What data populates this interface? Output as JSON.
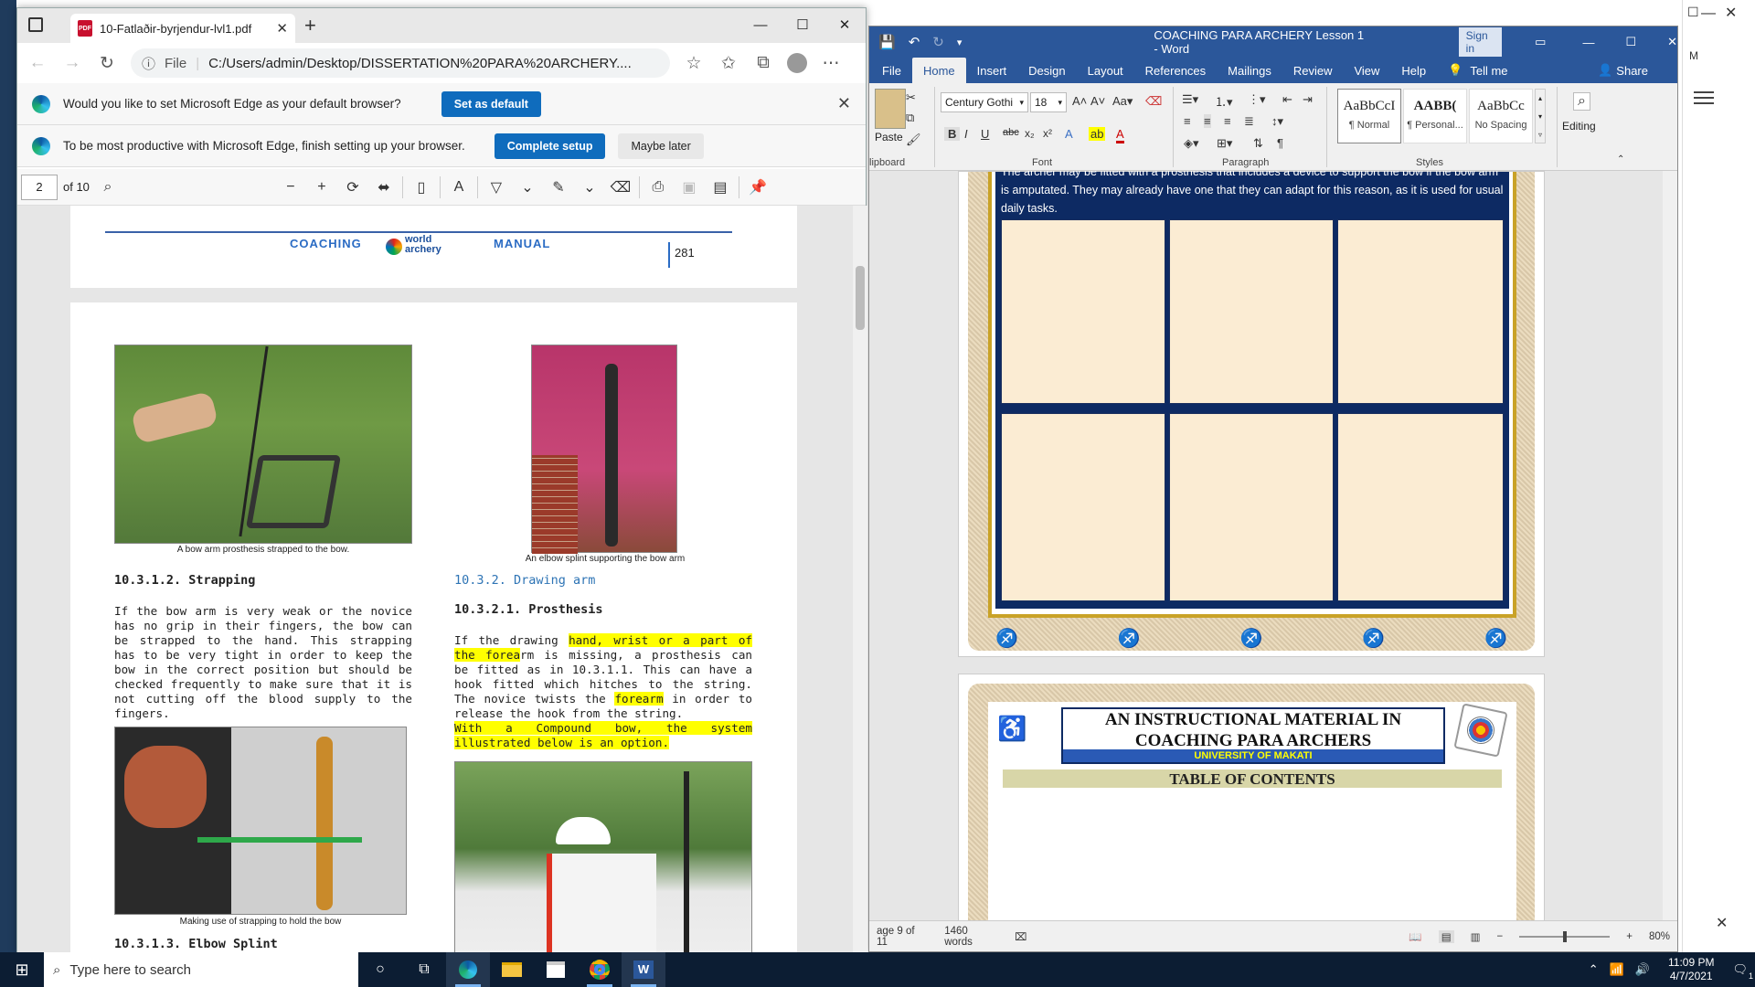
{
  "edge": {
    "tab_title": "10-Fatlaðir-byrjendur-lvl1.pdf",
    "url_scheme": "File",
    "url": "C:/Users/admin/Desktop/DISSERTATION%20PARA%20ARCHERY....",
    "infobar1_text": "Would you like to set Microsoft Edge as your default browser?",
    "infobar1_button": "Set as default",
    "infobar2_text": "To be most productive with Microsoft Edge, finish setting up your browser.",
    "infobar2_primary": "Complete setup",
    "infobar2_secondary": "Maybe later",
    "page_number": "2",
    "page_total": "of 10"
  },
  "pdf": {
    "header_left": "COACHING",
    "header_logo": "world archery",
    "header_right": "MANUAL",
    "page_num": "281",
    "cap1": "A bow arm prosthesis strapped to the bow.",
    "cap2": "An elbow splint supporting the bow arm",
    "cap3": "Making use of strapping to hold the bow",
    "h_strapping": "10.3.1.2. Strapping",
    "p_strapping": "If the bow arm is very weak or the novice has no grip in their fingers, the bow can be strapped to the hand. This strapping has to be very tight in order to keep the bow in the correct position but should be checked frequently to make sure that it is not cutting off the blood supply to the fingers.",
    "h_elbow": "10.3.1.3. Elbow Splint",
    "h_drawing": "10.3.2. Drawing arm",
    "h_prosthesis": "10.3.2.1. Prosthesis",
    "p_pros_a": "If the drawing ",
    "p_pros_hl1": "hand, wrist or a part of the forea",
    "p_pros_b": "rm is missing, a prosthesis can be fitted as in 10.3.1.1. This can have a hook fitted which hitches to the string. The novice twists the ",
    "p_pros_hl2": "forearm",
    "p_pros_c": " in order to release the hook from the string.",
    "p_pros_hl3": "With a Compound bow, the system illustrated below is an option."
  },
  "word": {
    "title": "COACHING PARA ARCHERY Lesson 1  -  Word",
    "sign_in": "Sign in",
    "tabs": [
      "File",
      "Home",
      "Insert",
      "Design",
      "Layout",
      "References",
      "Mailings",
      "Review",
      "View",
      "Help",
      "Tell me"
    ],
    "share": "Share",
    "avatar": "M",
    "paste": "Paste",
    "clipboard": "lipboard",
    "font_name": "Century Gothi",
    "font_size": "18",
    "group_font": "Font",
    "group_paragraph": "Paragraph",
    "group_styles": "Styles",
    "styles": [
      {
        "preview": "AaBbCcI",
        "name": "¶ Normal"
      },
      {
        "preview": "AABB(",
        "name": "¶ Personal..."
      },
      {
        "preview": "AaBbCc",
        "name": "No Spacing"
      }
    ],
    "editing": "Editing",
    "doc_text": "The archer may be fitted with a prosthesis that includes a device to support the bow if the bow arm is amputated. They may already have one that they can adapt for this reason, as it is used for usual daily tasks.",
    "next_title1": "AN INSTRUCTIONAL MATERIAL IN",
    "next_title2": "COACHING PARA ARCHERS",
    "next_univ": "UNIVERSITY OF MAKATI",
    "next_toc": "TABLE OF CONTENTS",
    "status_page": "age 9 of 11",
    "status_words": "1460 words",
    "zoom": "80%"
  },
  "taskbar": {
    "search_placeholder": "Type here to search",
    "time": "11:09 PM",
    "date": "4/7/2021",
    "notif_count": "1"
  },
  "colors": {
    "word_blue": "#2b579a",
    "edge_blue": "#0f6cbd",
    "doc_navy": "#0d2a63",
    "highlight": "#ffff00"
  }
}
